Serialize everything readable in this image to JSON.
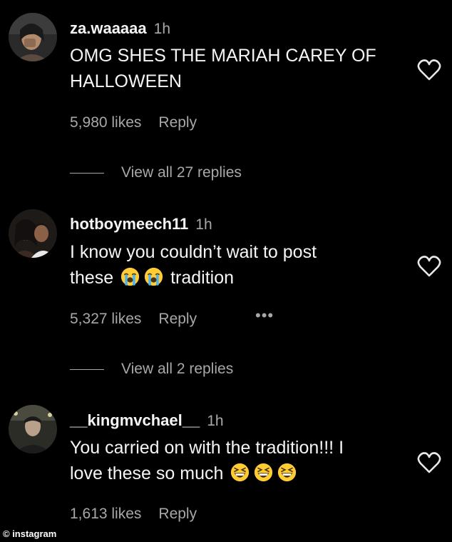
{
  "comments": [
    {
      "username": "za.waaaaa",
      "time": "1h",
      "text_line1": "OMG SHES THE MARIAH CAREY OF",
      "text_line2": "HALLOWEEN",
      "likes": "5,980 likes",
      "reply": "Reply",
      "view_replies": "View all 27 replies"
    },
    {
      "username": "hotboymeech11",
      "time": "1h",
      "text_line1": "I know you couldn’t wait to post",
      "text_line2_a": "these",
      "text_line2_b": "tradition",
      "emoji_line2": [
        "loudly-crying-face",
        "loudly-crying-face"
      ],
      "likes": "5,327 likes",
      "reply": "Reply",
      "more": "•••",
      "view_replies": "View all 2 replies"
    },
    {
      "username": "__kingmvchael__",
      "time": "1h",
      "text_line1": "You carried on with the tradition!!! I",
      "text_line2": "love these so much",
      "emoji_line2": [
        "grinning-squinting-face",
        "grinning-squinting-face",
        "grinning-squinting-face"
      ],
      "likes": "1,613 likes",
      "reply": "Reply"
    }
  ],
  "credit": "© instagram",
  "icons": {
    "like": "heart-outline-icon",
    "more": "more-options-icon"
  },
  "colors": {
    "background": "#000000",
    "text": "#f5f5f5",
    "secondary": "#a8a8a8",
    "emoji_yellow": "#ffcc33",
    "emoji_tear": "#4fb3f0"
  }
}
